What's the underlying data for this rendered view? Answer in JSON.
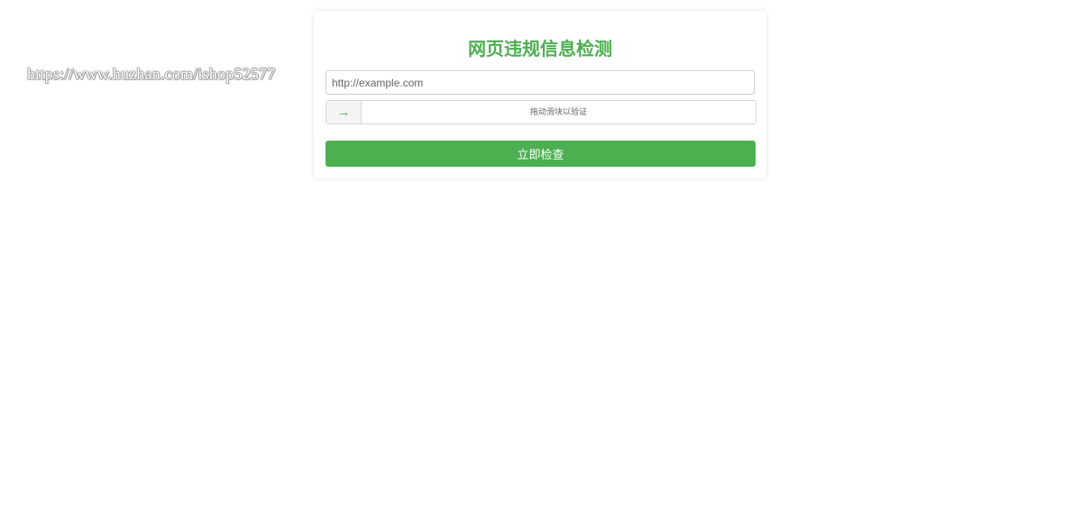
{
  "watermark": {
    "text": "https://www.huzhan.com/ishop52577"
  },
  "card": {
    "title": "网页违规信息检测",
    "url_input": {
      "value": "",
      "placeholder": "http://example.com"
    },
    "slider": {
      "handle_icon": "arrow-right-icon",
      "handle_glyph": "→",
      "hint": "拖动滑块以验证",
      "progress": 0
    },
    "submit_label": "立即检查"
  },
  "colors": {
    "accent": "#4caf50",
    "background": "#ffffff",
    "border": "#cfcfcf"
  }
}
